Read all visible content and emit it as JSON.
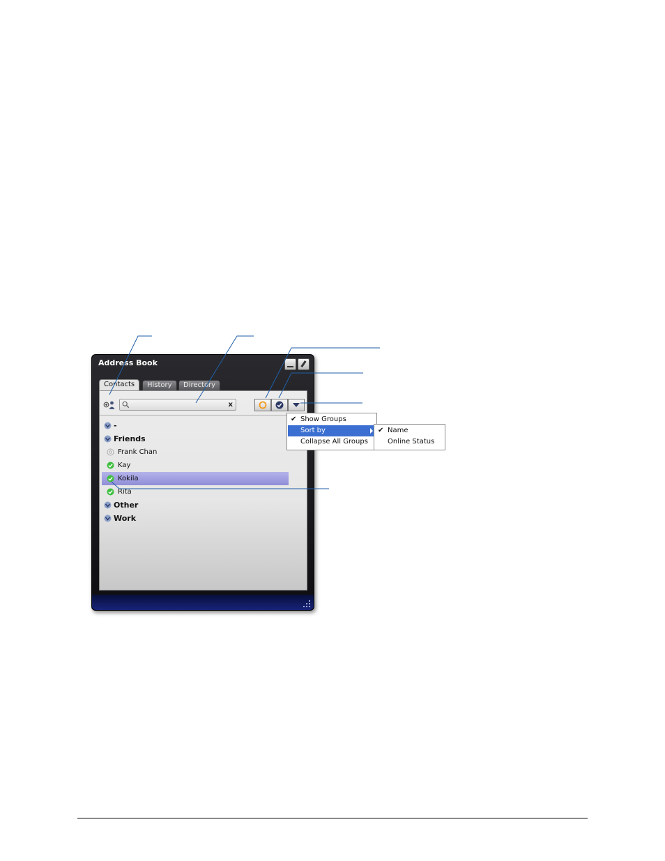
{
  "window": {
    "title": "Address Book",
    "tabs": [
      {
        "label": "Contacts",
        "active": true
      },
      {
        "label": "History",
        "active": false
      },
      {
        "label": "Directory",
        "active": false
      }
    ]
  },
  "toolbar": {
    "search": {
      "value": "",
      "placeholder": "",
      "clear_label": "x"
    },
    "filter_buttons": [
      "show-all-status-icon",
      "online-only-icon",
      "options-dropdown-icon"
    ]
  },
  "contacts": {
    "groups": [
      {
        "name": "-",
        "contacts": []
      },
      {
        "name": "Friends",
        "contacts": [
          {
            "name": "Frank Chan",
            "status": "offline"
          },
          {
            "name": "Kay",
            "status": "online"
          },
          {
            "name": "Kokila",
            "status": "online",
            "selected": true
          },
          {
            "name": "Rita",
            "status": "online"
          }
        ]
      },
      {
        "name": "Other",
        "contacts": []
      },
      {
        "name": "Work",
        "contacts": []
      }
    ]
  },
  "options_menu": {
    "items": [
      {
        "label": "Show Groups",
        "checked": true
      },
      {
        "label": "Sort by",
        "highlighted": true,
        "has_submenu": true
      },
      {
        "label": "Collapse All Groups",
        "checked": false
      }
    ]
  },
  "sort_submenu": {
    "items": [
      {
        "label": "Name",
        "checked": true
      },
      {
        "label": "Online Status",
        "checked": false
      }
    ]
  },
  "colors": {
    "window_bg": "#1a1a1e",
    "statusbar": "#17237a",
    "selection": "#9f9ee0",
    "menu_highlight": "#3b6fd1",
    "online_status": "#3fbf3f",
    "callout_line": "#1f5ea8"
  }
}
